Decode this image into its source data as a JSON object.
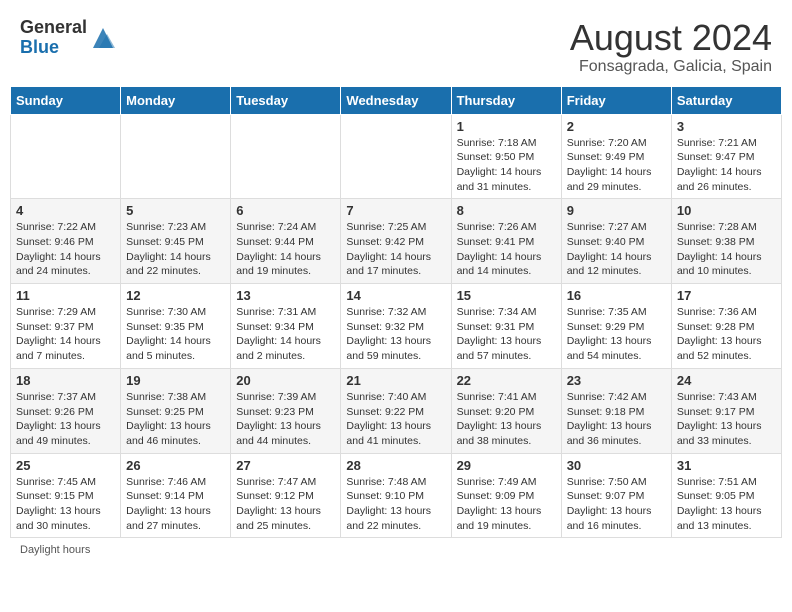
{
  "header": {
    "logo_general": "General",
    "logo_blue": "Blue",
    "month_title": "August 2024",
    "subtitle": "Fonsagrada, Galicia, Spain"
  },
  "weekdays": [
    "Sunday",
    "Monday",
    "Tuesday",
    "Wednesday",
    "Thursday",
    "Friday",
    "Saturday"
  ],
  "weeks": [
    [
      {
        "day": "",
        "info": ""
      },
      {
        "day": "",
        "info": ""
      },
      {
        "day": "",
        "info": ""
      },
      {
        "day": "",
        "info": ""
      },
      {
        "day": "1",
        "info": "Sunrise: 7:18 AM\nSunset: 9:50 PM\nDaylight: 14 hours and 31 minutes."
      },
      {
        "day": "2",
        "info": "Sunrise: 7:20 AM\nSunset: 9:49 PM\nDaylight: 14 hours and 29 minutes."
      },
      {
        "day": "3",
        "info": "Sunrise: 7:21 AM\nSunset: 9:47 PM\nDaylight: 14 hours and 26 minutes."
      }
    ],
    [
      {
        "day": "4",
        "info": "Sunrise: 7:22 AM\nSunset: 9:46 PM\nDaylight: 14 hours and 24 minutes."
      },
      {
        "day": "5",
        "info": "Sunrise: 7:23 AM\nSunset: 9:45 PM\nDaylight: 14 hours and 22 minutes."
      },
      {
        "day": "6",
        "info": "Sunrise: 7:24 AM\nSunset: 9:44 PM\nDaylight: 14 hours and 19 minutes."
      },
      {
        "day": "7",
        "info": "Sunrise: 7:25 AM\nSunset: 9:42 PM\nDaylight: 14 hours and 17 minutes."
      },
      {
        "day": "8",
        "info": "Sunrise: 7:26 AM\nSunset: 9:41 PM\nDaylight: 14 hours and 14 minutes."
      },
      {
        "day": "9",
        "info": "Sunrise: 7:27 AM\nSunset: 9:40 PM\nDaylight: 14 hours and 12 minutes."
      },
      {
        "day": "10",
        "info": "Sunrise: 7:28 AM\nSunset: 9:38 PM\nDaylight: 14 hours and 10 minutes."
      }
    ],
    [
      {
        "day": "11",
        "info": "Sunrise: 7:29 AM\nSunset: 9:37 PM\nDaylight: 14 hours and 7 minutes."
      },
      {
        "day": "12",
        "info": "Sunrise: 7:30 AM\nSunset: 9:35 PM\nDaylight: 14 hours and 5 minutes."
      },
      {
        "day": "13",
        "info": "Sunrise: 7:31 AM\nSunset: 9:34 PM\nDaylight: 14 hours and 2 minutes."
      },
      {
        "day": "14",
        "info": "Sunrise: 7:32 AM\nSunset: 9:32 PM\nDaylight: 13 hours and 59 minutes."
      },
      {
        "day": "15",
        "info": "Sunrise: 7:34 AM\nSunset: 9:31 PM\nDaylight: 13 hours and 57 minutes."
      },
      {
        "day": "16",
        "info": "Sunrise: 7:35 AM\nSunset: 9:29 PM\nDaylight: 13 hours and 54 minutes."
      },
      {
        "day": "17",
        "info": "Sunrise: 7:36 AM\nSunset: 9:28 PM\nDaylight: 13 hours and 52 minutes."
      }
    ],
    [
      {
        "day": "18",
        "info": "Sunrise: 7:37 AM\nSunset: 9:26 PM\nDaylight: 13 hours and 49 minutes."
      },
      {
        "day": "19",
        "info": "Sunrise: 7:38 AM\nSunset: 9:25 PM\nDaylight: 13 hours and 46 minutes."
      },
      {
        "day": "20",
        "info": "Sunrise: 7:39 AM\nSunset: 9:23 PM\nDaylight: 13 hours and 44 minutes."
      },
      {
        "day": "21",
        "info": "Sunrise: 7:40 AM\nSunset: 9:22 PM\nDaylight: 13 hours and 41 minutes."
      },
      {
        "day": "22",
        "info": "Sunrise: 7:41 AM\nSunset: 9:20 PM\nDaylight: 13 hours and 38 minutes."
      },
      {
        "day": "23",
        "info": "Sunrise: 7:42 AM\nSunset: 9:18 PM\nDaylight: 13 hours and 36 minutes."
      },
      {
        "day": "24",
        "info": "Sunrise: 7:43 AM\nSunset: 9:17 PM\nDaylight: 13 hours and 33 minutes."
      }
    ],
    [
      {
        "day": "25",
        "info": "Sunrise: 7:45 AM\nSunset: 9:15 PM\nDaylight: 13 hours and 30 minutes."
      },
      {
        "day": "26",
        "info": "Sunrise: 7:46 AM\nSunset: 9:14 PM\nDaylight: 13 hours and 27 minutes."
      },
      {
        "day": "27",
        "info": "Sunrise: 7:47 AM\nSunset: 9:12 PM\nDaylight: 13 hours and 25 minutes."
      },
      {
        "day": "28",
        "info": "Sunrise: 7:48 AM\nSunset: 9:10 PM\nDaylight: 13 hours and 22 minutes."
      },
      {
        "day": "29",
        "info": "Sunrise: 7:49 AM\nSunset: 9:09 PM\nDaylight: 13 hours and 19 minutes."
      },
      {
        "day": "30",
        "info": "Sunrise: 7:50 AM\nSunset: 9:07 PM\nDaylight: 13 hours and 16 minutes."
      },
      {
        "day": "31",
        "info": "Sunrise: 7:51 AM\nSunset: 9:05 PM\nDaylight: 13 hours and 13 minutes."
      }
    ]
  ],
  "footer": {
    "daylight_label": "Daylight hours"
  }
}
